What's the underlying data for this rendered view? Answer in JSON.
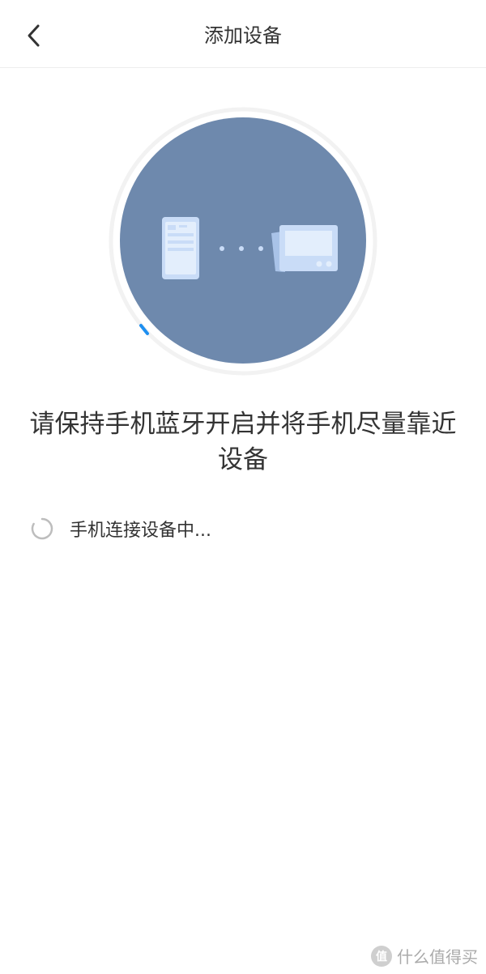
{
  "header": {
    "title": "添加设备",
    "back_icon": "chevron-left-icon"
  },
  "illustration": {
    "circle_color": "#6e89ad",
    "ring_color": "#f2f2f2",
    "progress_color": "#1e8ff0",
    "device_color": "#c9dcf7",
    "icons": [
      "phone-icon",
      "connecting-dots-icon",
      "device-screen-icon"
    ]
  },
  "instruction": {
    "text": "请保持手机蓝牙开启并将手机尽量靠近设备"
  },
  "status": {
    "text": "手机连接设备中...",
    "icon": "loading-spinner-icon"
  },
  "watermark": {
    "badge": "值",
    "text": "什么值得买"
  }
}
